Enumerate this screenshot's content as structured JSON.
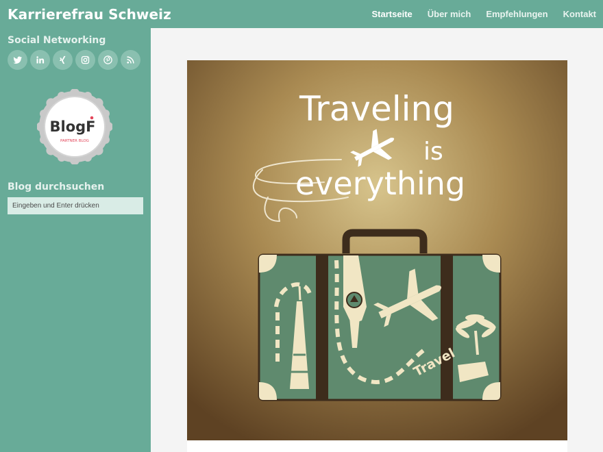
{
  "site": {
    "title": "Karrierefrau Schweiz"
  },
  "nav": {
    "items": [
      {
        "label": "Startseite",
        "active": true
      },
      {
        "label": "Über mich"
      },
      {
        "label": "Empfehlungen"
      },
      {
        "label": "Kontakt"
      }
    ]
  },
  "sidebar": {
    "social_heading": "Social Networking",
    "social_icons": [
      "twitter-icon",
      "linkedin-icon",
      "xing-icon",
      "instagram-icon",
      "pinterest-icon",
      "rss-icon"
    ],
    "badge": {
      "name": "BlogF",
      "subtitle": "PARTNER BLOG"
    },
    "search_heading": "Blog durchsuchen",
    "search_placeholder": "Eingeben und Enter drücken"
  },
  "post": {
    "image": {
      "line1": "Traveling",
      "line2": "is",
      "line3": "everything",
      "suitcase_label": "Travel"
    }
  },
  "colors": {
    "accent": "#68ab98",
    "icon_bg": "#8ac0b0",
    "suitcase": "#5f8a6e",
    "cream": "#f1e6c4"
  }
}
